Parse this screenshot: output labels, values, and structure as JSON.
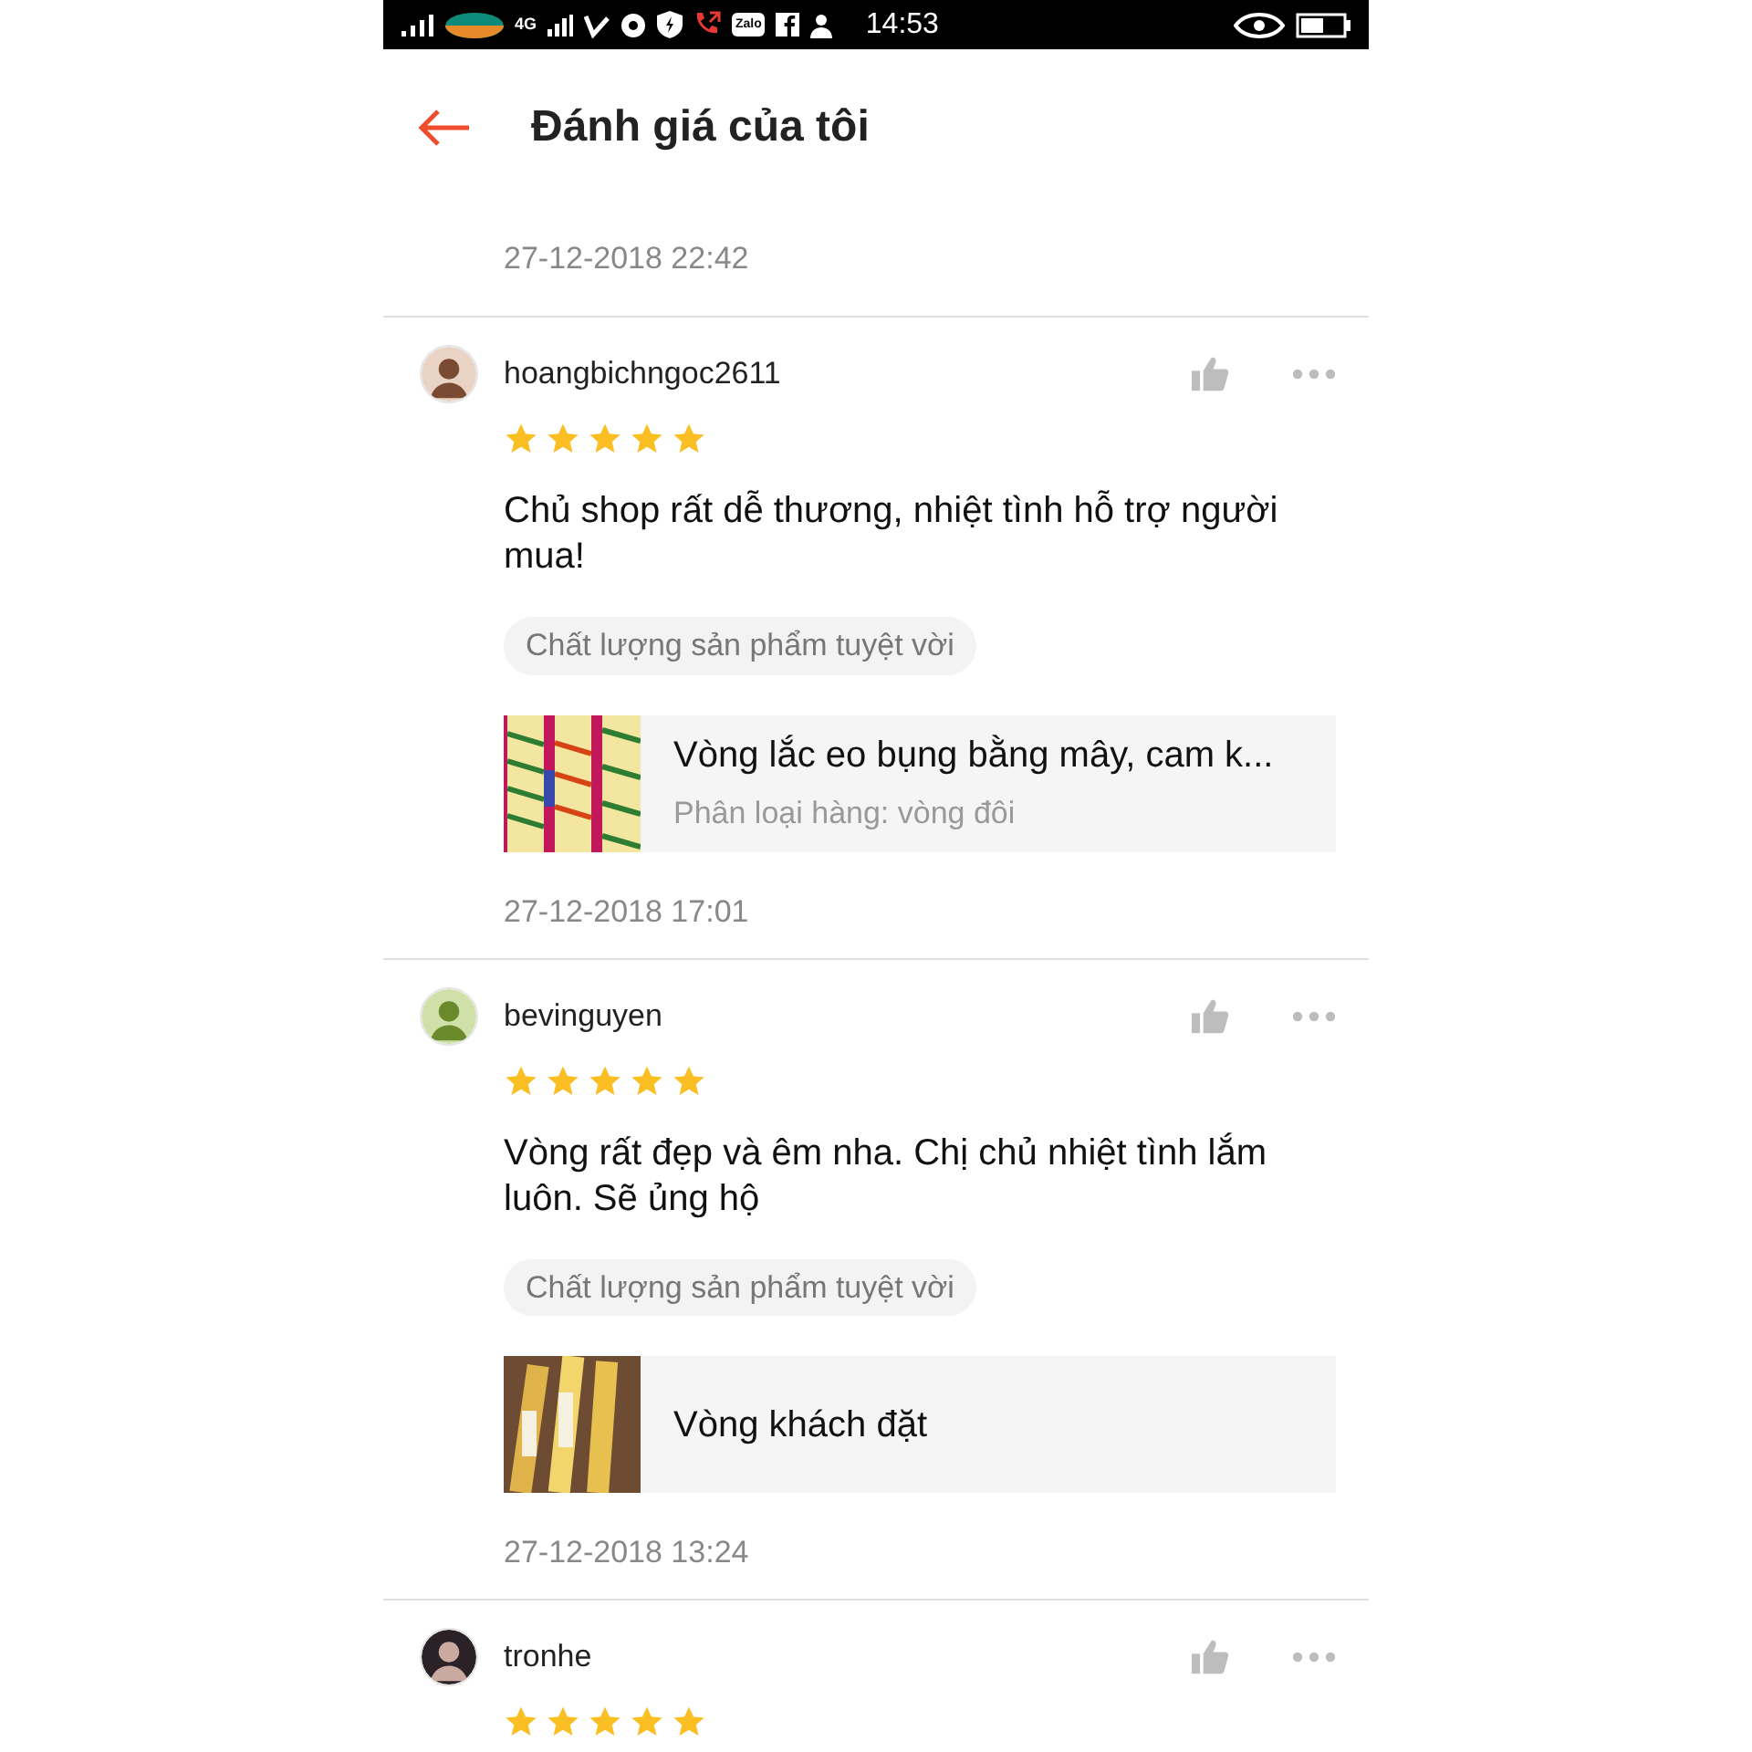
{
  "status_bar": {
    "network": "4G",
    "app_badge": "Zalo",
    "time": "14:53"
  },
  "header": {
    "title": "Đánh giá của tôi"
  },
  "top_date": "27-12-2018 22:42",
  "reviews": [
    {
      "user": "hoangbichngoc2611",
      "stars": 5,
      "comment": "Chủ shop rất dễ thương, nhiệt tình hỗ trợ người mua!",
      "tag": "Chất lượng sản phẩm tuyệt vời",
      "product": {
        "name": "Vòng lắc eo bụng bằng mây, cam k...",
        "variant": "Phân loại hàng: vòng đôi"
      },
      "date": "27-12-2018 17:01"
    },
    {
      "user": "bevinguyen",
      "stars": 5,
      "comment": "Vòng rất đẹp và êm nha. Chị chủ nhiệt tình lắm luôn. Sẽ ủng hộ",
      "tag": "Chất lượng sản phẩm tuyệt vời",
      "product": {
        "name": "Vòng khách đặt"
      },
      "date": "27-12-2018 13:24"
    },
    {
      "user": "tronhe",
      "stars": 5
    }
  ]
}
